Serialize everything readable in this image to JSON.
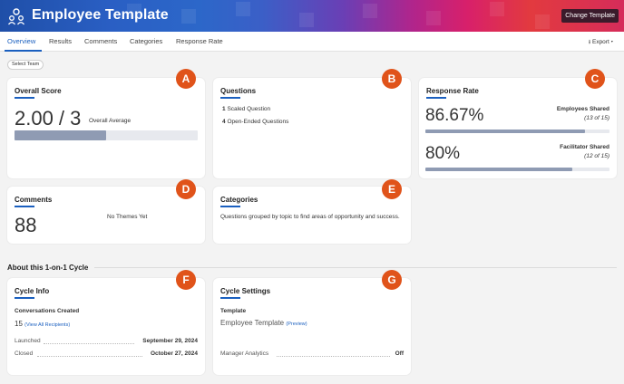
{
  "header": {
    "title": "Employee Template",
    "change_template_label": "Change Template",
    "brand_colors": [
      "#2a5fc4",
      "#b0258c",
      "#e23a3f"
    ]
  },
  "tabs": [
    {
      "label": "Overview",
      "active": true
    },
    {
      "label": "Results"
    },
    {
      "label": "Comments"
    },
    {
      "label": "Categories"
    },
    {
      "label": "Response Rate"
    }
  ],
  "export_label": "Export",
  "select_team_label": "Select Team",
  "badge_color": "#e0531a",
  "overall_score": {
    "badge": "A",
    "title": "Overall Score",
    "value": "2.00 / 3",
    "caption": "Overall Average",
    "fraction": 0.5
  },
  "questions": {
    "badge": "B",
    "title": "Questions",
    "scaled_count": "1",
    "scaled_label": "Scaled Question",
    "open_count": "4",
    "open_label": "Open-Ended Questions"
  },
  "response_rate": {
    "badge": "C",
    "title": "Response Rate",
    "employees_value": "86.67%",
    "employees_label": "Employees Shared",
    "employees_detail": "(13 of 15)",
    "employees_fraction": 0.8667,
    "facilitator_value": "80%",
    "facilitator_label": "Facilitator Shared",
    "facilitator_detail": "(12 of 15)",
    "facilitator_fraction": 0.8
  },
  "comments": {
    "badge": "D",
    "title": "Comments",
    "count": "88",
    "themes_text": "No Themes Yet"
  },
  "categories": {
    "badge": "E",
    "title": "Categories",
    "description": "Questions grouped by topic to find areas of opportunity and success."
  },
  "section_title": "About this 1-on-1 Cycle",
  "cycle_info": {
    "badge": "F",
    "title": "Cycle Info",
    "conversations_label": "Conversations Created",
    "conversations_count": "15",
    "view_all_label": "(View All Recipients)",
    "launched_label": "Launched",
    "launched_value": "September 29, 2024",
    "closed_label": "Closed",
    "closed_value": "October 27, 2024"
  },
  "cycle_settings": {
    "badge": "G",
    "title": "Cycle Settings",
    "template_label": "Template",
    "template_value": "Employee Template",
    "preview_label": "(Preview)",
    "manager_analytics_label": "Manager Analytics",
    "manager_analytics_value": "Off"
  }
}
